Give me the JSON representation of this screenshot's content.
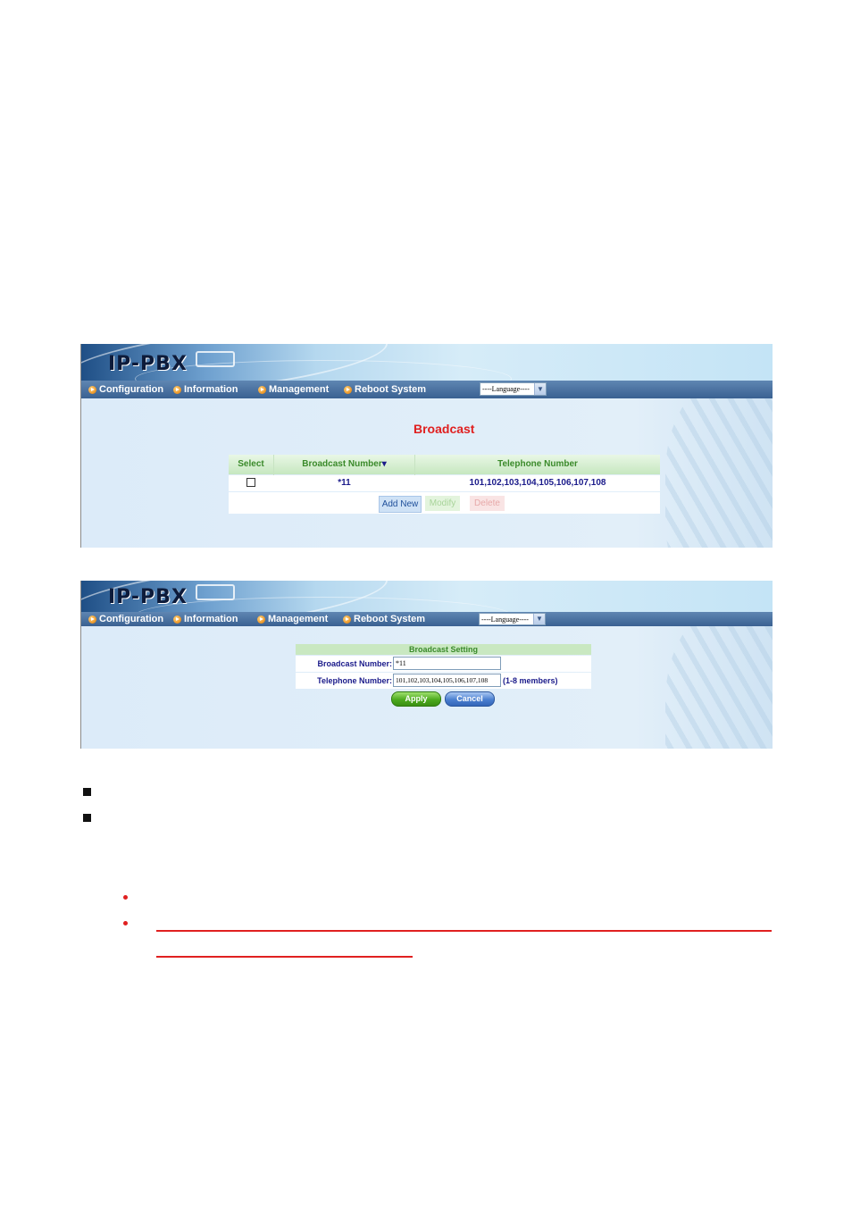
{
  "brand": {
    "logo_text": "IP-PBX"
  },
  "nav": {
    "items": [
      {
        "label": "Configuration",
        "icon": "arrow-bullet-icon"
      },
      {
        "label": "Information",
        "icon": "arrow-bullet-icon"
      },
      {
        "label": "Management",
        "icon": "arrow-bullet-icon"
      },
      {
        "label": "Reboot System",
        "icon": "arrow-bullet-icon"
      }
    ],
    "language_select": {
      "selected": "----Language----",
      "icon": "chevron-down-icon"
    }
  },
  "broadcast_list": {
    "title": "Broadcast",
    "columns": {
      "select": "Select",
      "broadcast_number": "Broadcast Number",
      "telephone_number": "Telephone Number"
    },
    "sort_indicator": "▾",
    "rows": [
      {
        "checked": false,
        "broadcast_number": "*11",
        "telephone_number": "101,102,103,104,105,106,107,108"
      }
    ],
    "buttons": {
      "add_new": "Add New",
      "modify": "Modify",
      "delete": "Delete"
    }
  },
  "broadcast_setting": {
    "title": "Broadcast Setting",
    "broadcast_number_label": "Broadcast Number:",
    "broadcast_number_value": "*11",
    "telephone_number_label": "Telephone Number:",
    "telephone_number_value": "101,102,103,104,105,106,107,108",
    "members_note": "(1-8 members)",
    "apply_label": "Apply",
    "cancel_label": "Cancel"
  },
  "colors": {
    "title_red": "#e02020",
    "header_green": "#3a8a2a",
    "nav_blue": "#3a6192",
    "text_navy": "#1a1a8a"
  }
}
